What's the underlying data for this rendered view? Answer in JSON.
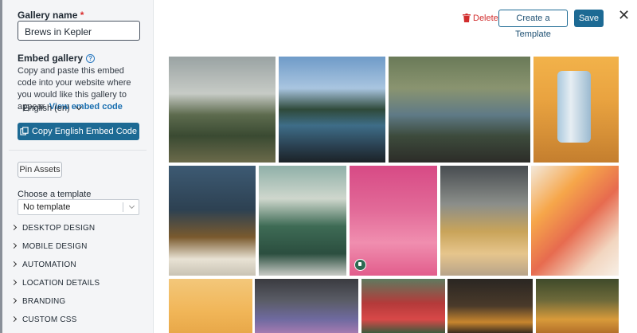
{
  "left": {
    "gallery_name_label": "Gallery name",
    "required_mark": "*",
    "gallery_name_value": "Brews in Kepler",
    "embed_label": "Embed gallery",
    "help_glyph": "?",
    "embed_desc": "Copy and paste this embed code into your website where you would like this gallery to appear.",
    "view_embed_link": "View embed code",
    "language": "English (en)",
    "copy_button": "Copy English Embed Code",
    "pin_button": "Pin Assets",
    "choose_template_label": "Choose a template",
    "template_select_value": "No template",
    "sections": [
      {
        "label": "DESKTOP DESIGN"
      },
      {
        "label": "MOBILE DESIGN"
      },
      {
        "label": "AUTOMATION"
      },
      {
        "label": "LOCATION DETAILS"
      },
      {
        "label": "BRANDING"
      },
      {
        "label": "CUSTOM CSS"
      }
    ]
  },
  "toolbar": {
    "delete_label": "Delete",
    "create_template_label": "Create a Template",
    "save_label": "Save",
    "close_glyph": "✕"
  },
  "colors": {
    "primary": "#1d6a94",
    "danger": "#d12d2d",
    "sidebar_bg": "#f4f5f7"
  }
}
